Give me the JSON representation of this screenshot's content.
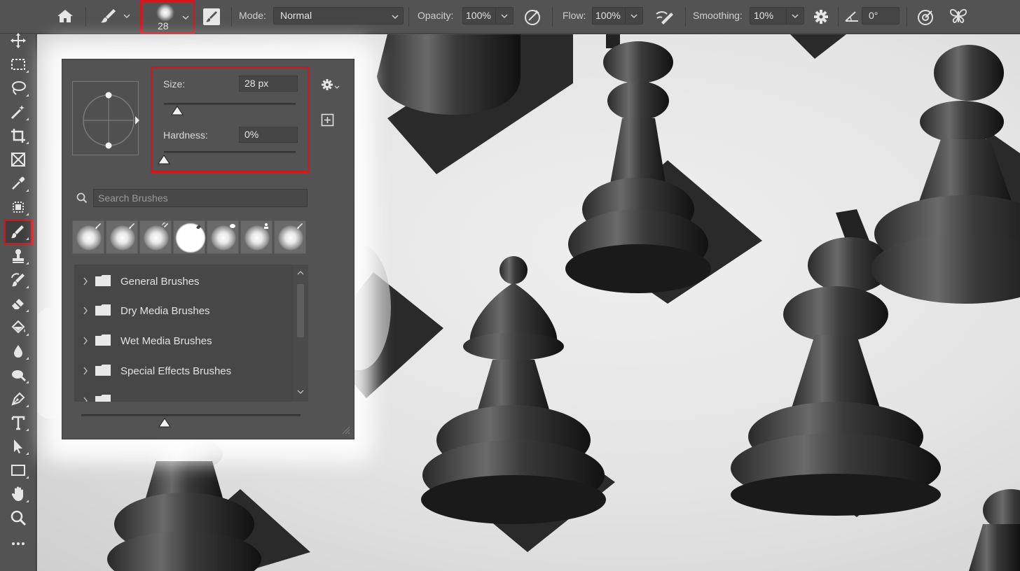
{
  "optionsBar": {
    "brushSize": "28",
    "modeLabel": "Mode:",
    "modeValue": "Normal",
    "opacityLabel": "Opacity:",
    "opacityValue": "100%",
    "flowLabel": "Flow:",
    "flowValue": "100%",
    "smoothingLabel": "Smoothing:",
    "smoothingValue": "10%",
    "angleValue": "0°"
  },
  "brushPanel": {
    "sizeLabel": "Size:",
    "sizeValue": "28 px",
    "sizeLevel": 0.1,
    "hardnessLabel": "Hardness:",
    "hardnessValue": "0%",
    "hardnessLevel": 0.0,
    "searchPlaceholder": "Search Brushes",
    "folders": [
      "General Brushes",
      "Dry Media Brushes",
      "Wet Media Brushes",
      "Special Effects Brushes"
    ],
    "previewScaleLevel": 0.38
  },
  "toolbar": {
    "activeTool": "brush-tool",
    "tools": [
      "move-tool",
      "rectangular-marquee-tool",
      "lasso-tool",
      "magic-wand-tool",
      "crop-tool",
      "frame-tool",
      "eyedropper-tool",
      "spot-healing-brush-tool",
      "brush-tool",
      "clone-stamp-tool",
      "history-brush-tool",
      "eraser-tool",
      "paint-bucket-tool",
      "blur-tool",
      "dodge-tool",
      "pen-tool",
      "type-tool",
      "path-selection-tool",
      "rectangle-tool",
      "hand-tool",
      "zoom-tool",
      "more-tools"
    ]
  },
  "colors": {
    "highlight": "#d7161b",
    "ui": "#535353",
    "field": "#454545"
  }
}
